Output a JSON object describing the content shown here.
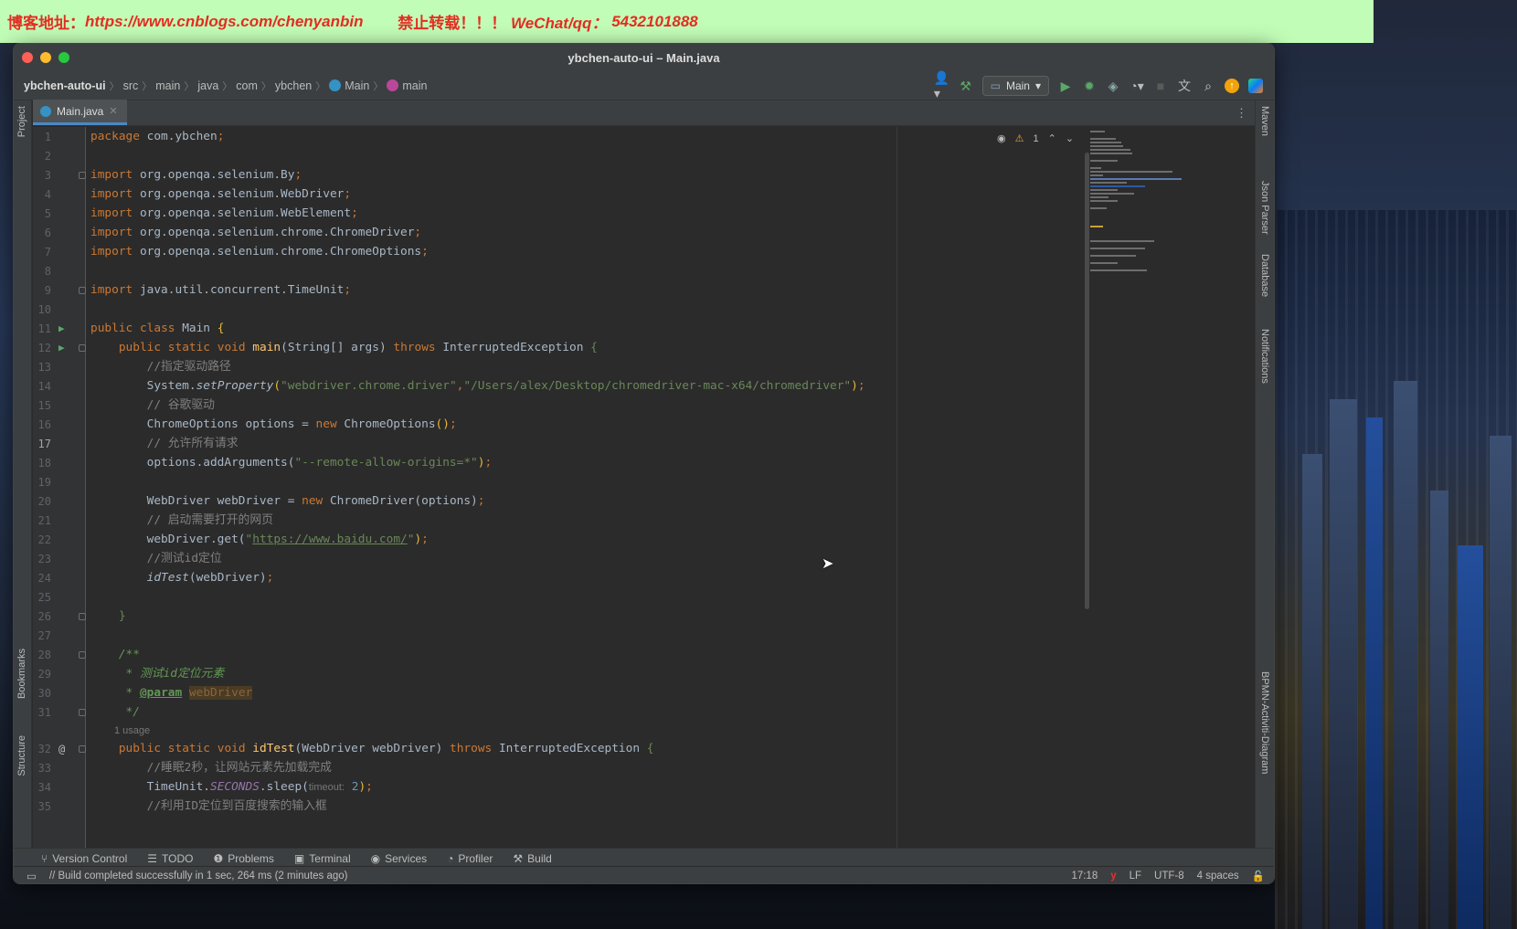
{
  "banner": {
    "label_blog": "博客地址：",
    "url": "https://www.cnblogs.com/chenyanbin",
    "no_repost": "禁止转载！！！",
    "wechat_label": "WeChat/qq：",
    "wechat_value": "5432101888"
  },
  "window": {
    "title": "ybchen-auto-ui – Main.java"
  },
  "breadcrumb": [
    "ybchen-auto-ui",
    "src",
    "main",
    "java",
    "com",
    "ybchen",
    "Main",
    "main"
  ],
  "toolbar": {
    "run_config": "Main"
  },
  "tabs": [
    {
      "label": "Main.java"
    }
  ],
  "left_tools": {
    "project": "Project",
    "bookmarks": "Bookmarks",
    "structure": "Structure"
  },
  "right_tools": {
    "maven": "Maven",
    "json_parser": "Json Parser",
    "database": "Database",
    "notifications": "Notifications",
    "bpmn": "BPMN-Activiti-Diagram"
  },
  "inspection": {
    "warnings": "1"
  },
  "editor": {
    "lines": [
      {
        "n": "1"
      },
      {
        "n": "2"
      },
      {
        "n": "3"
      },
      {
        "n": "4"
      },
      {
        "n": "5"
      },
      {
        "n": "6"
      },
      {
        "n": "7"
      },
      {
        "n": "8"
      },
      {
        "n": "9"
      },
      {
        "n": "10"
      },
      {
        "n": "11"
      },
      {
        "n": "12"
      },
      {
        "n": "13"
      },
      {
        "n": "14"
      },
      {
        "n": "15"
      },
      {
        "n": "16"
      },
      {
        "n": "17"
      },
      {
        "n": "18"
      },
      {
        "n": "19"
      },
      {
        "n": "20"
      },
      {
        "n": "21"
      },
      {
        "n": "22"
      },
      {
        "n": "23"
      },
      {
        "n": "24"
      },
      {
        "n": "25"
      },
      {
        "n": "26"
      },
      {
        "n": "27"
      },
      {
        "n": "28"
      },
      {
        "n": "29"
      },
      {
        "n": "30"
      },
      {
        "n": "31"
      },
      {
        "n": "32"
      },
      {
        "n": "33"
      },
      {
        "n": "34"
      },
      {
        "n": "35"
      }
    ],
    "tokens": {
      "package": "package",
      "pkg": " com.ybchen",
      "semi": ";",
      "import": "import",
      "imp_by": " org.openqa.selenium.By",
      "imp_wd": " org.openqa.selenium.WebDriver",
      "imp_we": " org.openqa.selenium.WebElement",
      "imp_cd": " org.openqa.selenium.chrome.ChromeDriver",
      "imp_co": " org.openqa.selenium.chrome.ChromeOptions",
      "imp_tu": " java.util.concurrent.TimeUnit",
      "public": "public",
      "class": "class",
      "static": "static",
      "void": "void",
      "throws": "throws",
      "new": "new",
      "main_cls": " Main ",
      "main_fn": "main",
      "main_args": "(String[] args) ",
      "ie": " InterruptedException ",
      "c13": "//指定驱动路径",
      "sys": "System.",
      "setprop": "setProperty",
      "s14a": "\"webdriver.chrome.driver\"",
      "s14b": "\"/Users/alex/Desktop/chromedriver-mac-x64/chromedriver\"",
      "c15": "// 谷歌驱动",
      "l16a": "ChromeOptions options = ",
      "l16b": " ChromeOptions",
      "c17": "// 允许所有请求",
      "l18a": "options.addArguments(",
      "s18": "\"--remote-allow-origins=*\"",
      "l20a": "WebDriver webDriver = ",
      "l20b": " ChromeDriver(options)",
      "c21": "// 启动需要打开的网页",
      "l22a": "webDriver.get(",
      "s22q": "\"",
      "s22u": "https://www.baidu.com/",
      "c23": "//测试id定位",
      "l24a": "idTest",
      "l24b": "(webDriver)",
      "close": "}",
      "d28": "/**",
      "d29": " * 测试id定位元素",
      "d30a": " * ",
      "d30t": "@param",
      "d30p": "webDriver",
      "d31": " */",
      "usage": "1 usage",
      "fn32": "idTest",
      "args32": "(WebDriver webDriver) ",
      "c33": "//睡眠2秒，让网站元素先加载完成",
      "l34a": "TimeUnit.",
      "l34b": "SECONDS",
      "l34c": ".sleep(",
      "hint34": "timeout:",
      "n34": "2",
      "c35": "//利用ID定位到百度搜索的输入框"
    }
  },
  "bottom_tools": [
    "Version Control",
    "TODO",
    "Problems",
    "Terminal",
    "Services",
    "Profiler",
    "Build"
  ],
  "status": {
    "message": "// Build completed successfully in 1 sec, 264 ms (2 minutes ago)",
    "position": "17:18",
    "line_sep": "LF",
    "encoding": "UTF-8",
    "indent": "4 spaces"
  },
  "colors": {
    "accent": "#4a88c7",
    "banner_bg": "#c2fdb7",
    "banner_text": "#e52d22",
    "run_green": "#59a869"
  }
}
